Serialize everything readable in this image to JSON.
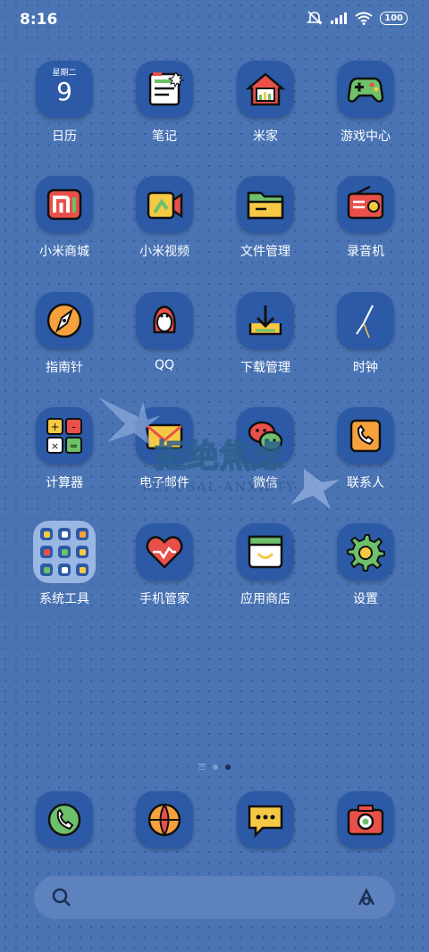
{
  "status_bar": {
    "time": "8:16",
    "battery": "100"
  },
  "apps": [
    {
      "label": "日历",
      "icon": "calendar-icon",
      "weekday": "星期二",
      "day": "9"
    },
    {
      "label": "笔记",
      "icon": "notes-icon"
    },
    {
      "label": "米家",
      "icon": "mijia-home-icon"
    },
    {
      "label": "游戏中心",
      "icon": "gamepad-icon"
    },
    {
      "label": "小米商城",
      "icon": "mi-store-icon"
    },
    {
      "label": "小米视频",
      "icon": "video-icon"
    },
    {
      "label": "文件管理",
      "icon": "folder-icon"
    },
    {
      "label": "录音机",
      "icon": "recorder-icon"
    },
    {
      "label": "指南针",
      "icon": "compass-icon"
    },
    {
      "label": "QQ",
      "icon": "qq-penguin-icon"
    },
    {
      "label": "下载管理",
      "icon": "download-icon"
    },
    {
      "label": "时钟",
      "icon": "clock-icon"
    },
    {
      "label": "计算器",
      "icon": "calculator-icon"
    },
    {
      "label": "电子邮件",
      "icon": "mail-icon"
    },
    {
      "label": "微信",
      "icon": "wechat-icon"
    },
    {
      "label": "联系人",
      "icon": "contacts-icon"
    },
    {
      "label": "系统工具",
      "icon": "folder-group-icon"
    },
    {
      "label": "手机管家",
      "icon": "security-heart-icon"
    },
    {
      "label": "应用商店",
      "icon": "app-store-icon"
    },
    {
      "label": "设置",
      "icon": "gear-icon"
    }
  ],
  "dock": [
    {
      "icon": "phone-icon"
    },
    {
      "icon": "browser-icon"
    },
    {
      "icon": "messages-icon"
    },
    {
      "icon": "camera-icon"
    }
  ],
  "watermark": {
    "title": "拒绝焦虑",
    "subtitle": "REFUSAL ANXIETY"
  },
  "colors": {
    "background": "#4a74b4",
    "tile": "#2d5aa6",
    "accent_yellow": "#f6c945",
    "accent_red": "#e9504a",
    "accent_green": "#6ec06a"
  }
}
